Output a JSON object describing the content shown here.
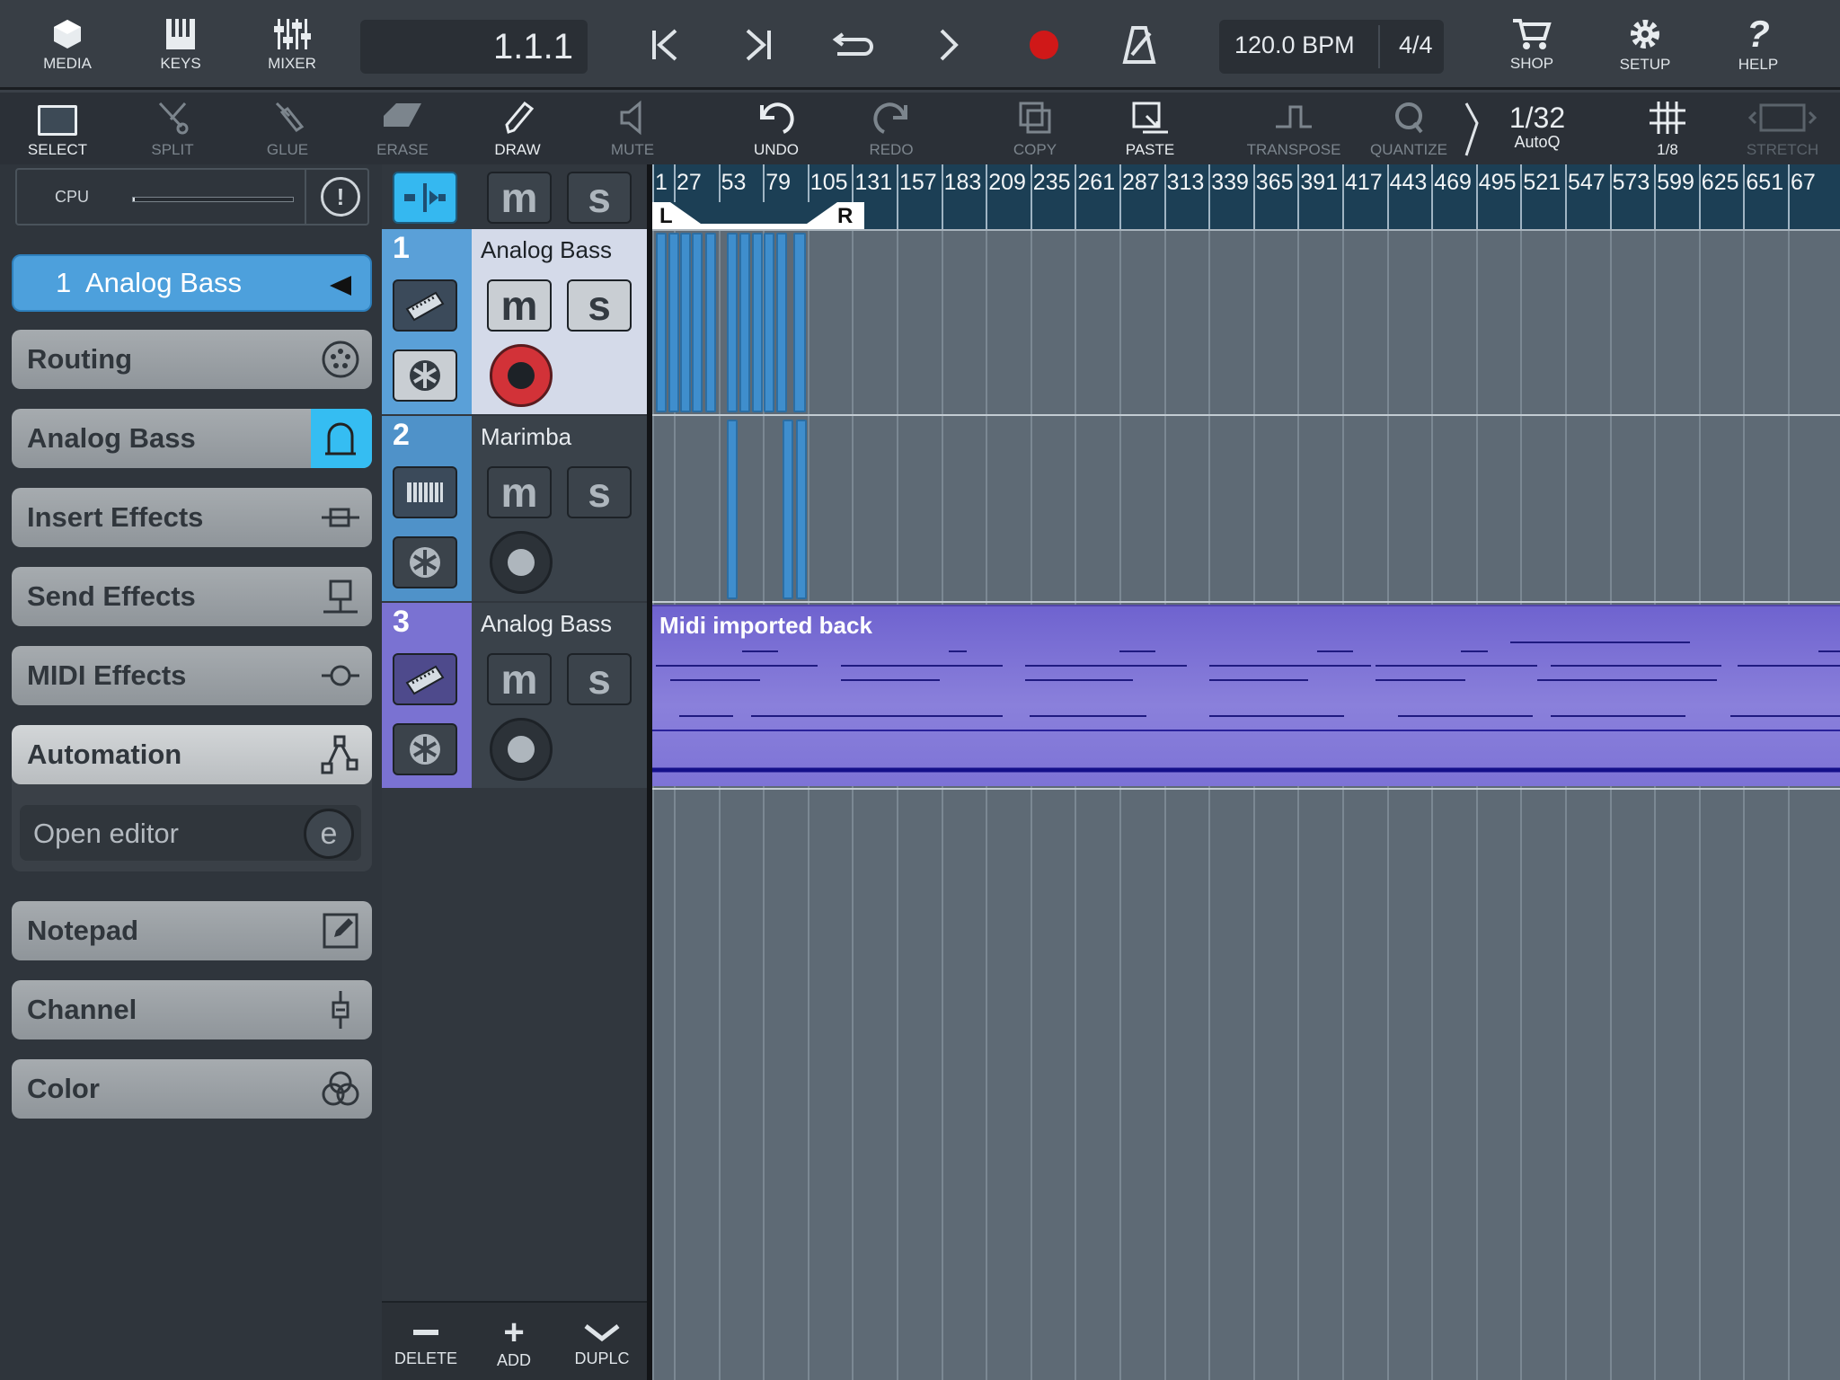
{
  "topbar": {
    "media": "MEDIA",
    "keys": "KEYS",
    "mixer": "MIXER",
    "position": "1.1.1",
    "tempo": "120.0 BPM",
    "signature": "4/4",
    "shop": "SHOP",
    "setup": "SETUP",
    "help": "HELP",
    "record_color": "#d01818"
  },
  "toolbar": {
    "select": "SELECT",
    "split": "SPLIT",
    "glue": "GLUE",
    "erase": "ERASE",
    "draw": "DRAW",
    "mute": "MUTE",
    "undo": "UNDO",
    "redo": "REDO",
    "copy": "COPY",
    "paste": "PASTE",
    "transpose": "TRANSPOSE",
    "quantize": "QUANTIZE",
    "quantize_value": "1/32",
    "autoq": "AutoQ",
    "grid_value": "1/8",
    "stretch": "STRETCH"
  },
  "cpu": {
    "label": "CPU"
  },
  "inspector": {
    "track_number": "1",
    "track_name": "Analog Bass",
    "items": [
      "Routing",
      "Analog Bass",
      "Insert Effects",
      "Send Effects",
      "MIDI Effects",
      "Automation"
    ],
    "open_editor": "Open editor",
    "items2": [
      "Notepad",
      "Channel",
      "Color"
    ]
  },
  "track_header": {
    "m": "m",
    "s": "s"
  },
  "tracks": [
    {
      "number": "1",
      "name": "Analog Bass",
      "m": "m",
      "s": "s",
      "color": "#5aa0d8"
    },
    {
      "number": "2",
      "name": "Marimba",
      "m": "m",
      "s": "s",
      "color": "#4f92c9"
    },
    {
      "number": "3",
      "name": "Analog Bass",
      "m": "m",
      "s": "s",
      "color": "#7a72d2"
    }
  ],
  "ruler": {
    "marks": [
      "1",
      "27",
      "53",
      "79",
      "105",
      "131",
      "157",
      "183",
      "209",
      "235",
      "261",
      "287",
      "313",
      "339",
      "365",
      "391",
      "417",
      "443",
      "469",
      "495",
      "521",
      "547",
      "573",
      "599",
      "625",
      "651",
      "67"
    ],
    "left_locator": "L",
    "right_locator": "R"
  },
  "clip": {
    "name": "Midi imported back"
  },
  "bottom": {
    "delete": "DELETE",
    "add": "ADD",
    "duplicate": "DUPLC"
  }
}
